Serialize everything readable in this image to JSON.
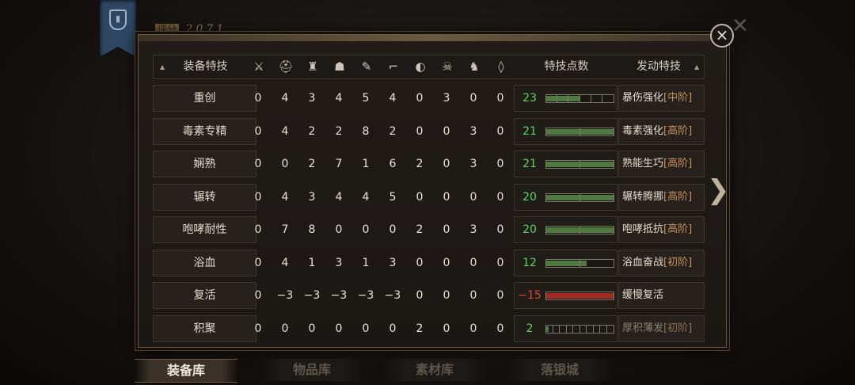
{
  "score": {
    "label": "评分",
    "value": "2071"
  },
  "close_label": "×",
  "header": {
    "skill_col": "装备特技",
    "points_col": "特技点数",
    "trigger_col": "发动特技",
    "slot_icons": [
      "sword-icon",
      "helmet-icon",
      "chest-armor-icon",
      "shoulder-icon",
      "bracer-icon",
      "boots-icon",
      "ring-icon",
      "mask-icon",
      "horse-icon",
      "amulet-icon"
    ],
    "slot_glyphs": [
      "⚔",
      "⛑",
      "♜",
      "☗",
      "✎",
      "⌐",
      "◐",
      "☠",
      "♞",
      "◊"
    ]
  },
  "rows": [
    {
      "name": "重创",
      "vals": [
        "0",
        "4",
        "3",
        "4",
        "5",
        "4",
        "0",
        "3",
        "0",
        "0"
      ],
      "points": "23",
      "fill_ratio": 0.5,
      "segments": 6,
      "trigger": "暴伤强化",
      "tier": "[中阶]",
      "negative": false,
      "dim": false
    },
    {
      "name": "毒素专精",
      "vals": [
        "0",
        "4",
        "2",
        "2",
        "8",
        "2",
        "0",
        "0",
        "3",
        "0"
      ],
      "points": "21",
      "fill_ratio": 1.0,
      "segments": 2,
      "trigger": "毒素强化",
      "tier": "[高阶]",
      "negative": false,
      "dim": false
    },
    {
      "name": "娴熟",
      "vals": [
        "0",
        "0",
        "2",
        "7",
        "1",
        "6",
        "2",
        "0",
        "3",
        "0"
      ],
      "points": "21",
      "fill_ratio": 1.0,
      "segments": 2,
      "trigger": "熟能生巧",
      "tier": "[高阶]",
      "negative": false,
      "dim": false
    },
    {
      "name": "辗转",
      "vals": [
        "0",
        "4",
        "3",
        "4",
        "4",
        "5",
        "0",
        "0",
        "0",
        "0"
      ],
      "points": "20",
      "fill_ratio": 1.0,
      "segments": 2,
      "trigger": "辗转腾挪",
      "tier": "[高阶]",
      "negative": false,
      "dim": false
    },
    {
      "name": "咆哮耐性",
      "vals": [
        "0",
        "7",
        "8",
        "0",
        "0",
        "0",
        "2",
        "0",
        "3",
        "0"
      ],
      "points": "20",
      "fill_ratio": 1.0,
      "segments": 2,
      "trigger": "咆哮抵抗",
      "tier": "[高阶]",
      "negative": false,
      "dim": false
    },
    {
      "name": "浴血",
      "vals": [
        "0",
        "4",
        "1",
        "3",
        "1",
        "3",
        "0",
        "0",
        "0",
        "0"
      ],
      "points": "12",
      "fill_ratio": 0.6,
      "segments": 2,
      "trigger": "浴血奋战",
      "tier": "[初阶]",
      "negative": false,
      "dim": false
    },
    {
      "name": "复活",
      "vals": [
        "0",
        "−3",
        "−3",
        "−3",
        "−3",
        "−3",
        "0",
        "0",
        "0",
        "0"
      ],
      "points": "−15",
      "fill_ratio": 1.0,
      "segments": 1,
      "trigger": "缓慢复活",
      "tier": "",
      "negative": true,
      "dim": false
    },
    {
      "name": "积聚",
      "vals": [
        "0",
        "0",
        "0",
        "0",
        "0",
        "0",
        "2",
        "0",
        "0",
        "0"
      ],
      "points": "2",
      "fill_ratio": 0.04,
      "segments": 10,
      "trigger": "厚积薄发",
      "tier": "[初阶]",
      "negative": false,
      "dim": true
    }
  ],
  "tabs": [
    {
      "label": "装备库",
      "active": true
    },
    {
      "label": "物品库",
      "active": false
    },
    {
      "label": "素材库",
      "active": false
    },
    {
      "label": "落银城",
      "active": false
    }
  ],
  "colors": {
    "positive": "#5fd45a",
    "negative": "#e0463a",
    "tier": "#c7905a",
    "bar_green": "#4f7a3f",
    "bar_red": "#a12a22"
  }
}
